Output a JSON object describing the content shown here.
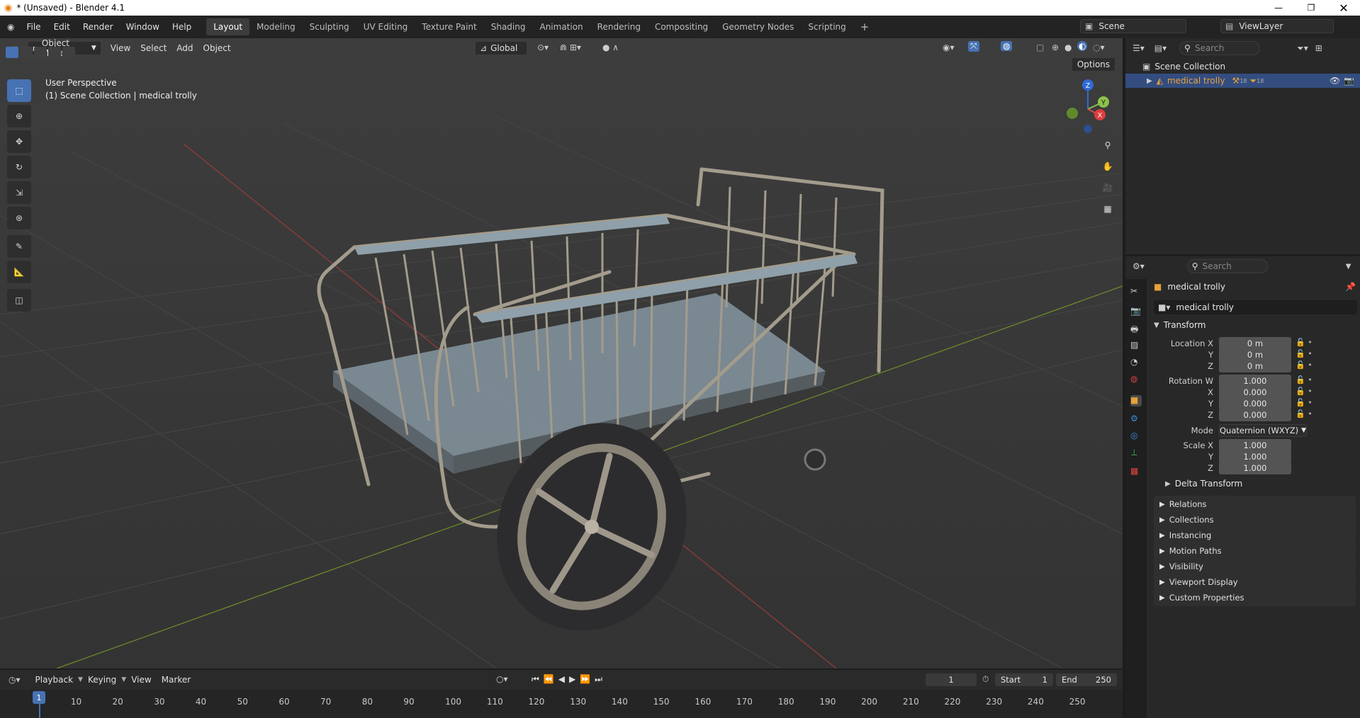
{
  "window": {
    "title": "* (Unsaved) - Blender 4.1"
  },
  "menus": [
    "File",
    "Edit",
    "Render",
    "Window",
    "Help"
  ],
  "workspaces": [
    "Layout",
    "Modeling",
    "Sculpting",
    "UV Editing",
    "Texture Paint",
    "Shading",
    "Animation",
    "Rendering",
    "Compositing",
    "Geometry Nodes",
    "Scripting"
  ],
  "active_workspace": "Layout",
  "scene": {
    "name": "Scene",
    "view_layer": "ViewLayer"
  },
  "viewport": {
    "mode": "Object Mode",
    "menus": [
      "View",
      "Select",
      "Add",
      "Object"
    ],
    "orientation": "Global",
    "options_label": "Options",
    "overlay_line1": "User Perspective",
    "overlay_line2": "(1) Scene Collection | medical trolly",
    "gizmo": {
      "z": "Z",
      "y": "Y",
      "x": "X"
    }
  },
  "outliner": {
    "search_placeholder": "Search",
    "collection": "Scene Collection",
    "object": "medical trolly",
    "badge1": "18",
    "badge2": "18"
  },
  "properties": {
    "search_placeholder": "Search",
    "object_name": "medical trolly",
    "datablock": "medical trolly",
    "transform_title": "Transform",
    "location_label": "Location X",
    "loc_x": "0 m",
    "loc_y": "0 m",
    "loc_z": "0 m",
    "rotation_label": "Rotation W",
    "rot_w": "1.000",
    "rot_x": "0.000",
    "rot_y": "0.000",
    "rot_z": "0.000",
    "mode_label": "Mode",
    "mode_value": "Quaternion (WXYZ)",
    "scale_label": "Scale X",
    "scale_x": "1.000",
    "scale_y": "1.000",
    "scale_z": "1.000",
    "axis_y": "Y",
    "axis_z": "Z",
    "axis_x": "X",
    "delta": "Delta Transform",
    "panels": [
      "Relations",
      "Collections",
      "Instancing",
      "Motion Paths",
      "Visibility",
      "Viewport Display",
      "Custom Properties"
    ]
  },
  "timeline": {
    "menus": [
      "Playback",
      "Keying",
      "View",
      "Marker"
    ],
    "current_frame": "1",
    "start_label": "Start",
    "start": "1",
    "end_label": "End",
    "end": "250",
    "ticks": [
      "1",
      "10",
      "20",
      "30",
      "40",
      "50",
      "60",
      "70",
      "80",
      "90",
      "100",
      "110",
      "120",
      "130",
      "140",
      "150",
      "160",
      "170",
      "180",
      "190",
      "200",
      "210",
      "220",
      "230",
      "240",
      "250"
    ]
  },
  "colors": {
    "accent": "#4772b3",
    "selection": "#e8a23a",
    "header": "#232323",
    "viewport": "#393939"
  }
}
